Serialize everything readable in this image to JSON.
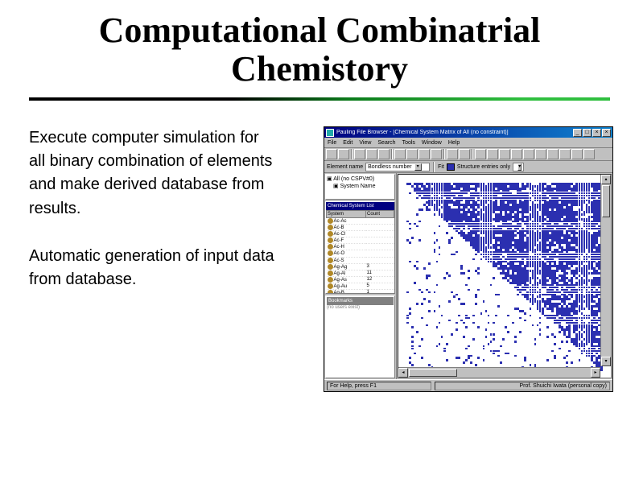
{
  "slide": {
    "title": "Computational Combinatrial Chemistory",
    "para1_l1": "Execute computer simulation for",
    "para1_l2": "all binary combination of elements",
    "para1_l3": "and make derived database from",
    "para1_l4": "results.",
    "para2_l1": "Automatic generation of input data",
    "para2_l2": "from database."
  },
  "app": {
    "title": "Pauling File Browser - [Chemical System Matrix of All (no constraint)]",
    "menu": [
      "File",
      "Edit",
      "View",
      "Search",
      "Tools",
      "Window",
      "Help"
    ],
    "filter": {
      "element_label": "Element name",
      "element_value": "Bondless number",
      "fit_label": "Fit",
      "structure_label": "Structure entries only"
    },
    "tree": {
      "root": "All (no CSPV#0)",
      "child": "System Name"
    },
    "list": {
      "headers": [
        "System",
        "Count"
      ],
      "rows": [
        {
          "name": "Ac-Ac",
          "val": ""
        },
        {
          "name": "Ac-B",
          "val": ""
        },
        {
          "name": "Ac-Cl",
          "val": ""
        },
        {
          "name": "Ac-F",
          "val": ""
        },
        {
          "name": "Ac-H",
          "val": ""
        },
        {
          "name": "Ac-O",
          "val": ""
        },
        {
          "name": "Ac-S",
          "val": ""
        },
        {
          "name": "Ag-Ag",
          "val": "3"
        },
        {
          "name": "Ag-Al",
          "val": "11"
        },
        {
          "name": "Ag-As",
          "val": "12"
        },
        {
          "name": "Ag-Au",
          "val": "5"
        },
        {
          "name": "Ag-B",
          "val": "1"
        }
      ]
    },
    "bookmark_header": "Bookmarks",
    "bookmark_body": "(no users exist)",
    "status_left": "For Help, press F1",
    "status_right": "Prof. Shuichi Iwata (personal copy)"
  }
}
